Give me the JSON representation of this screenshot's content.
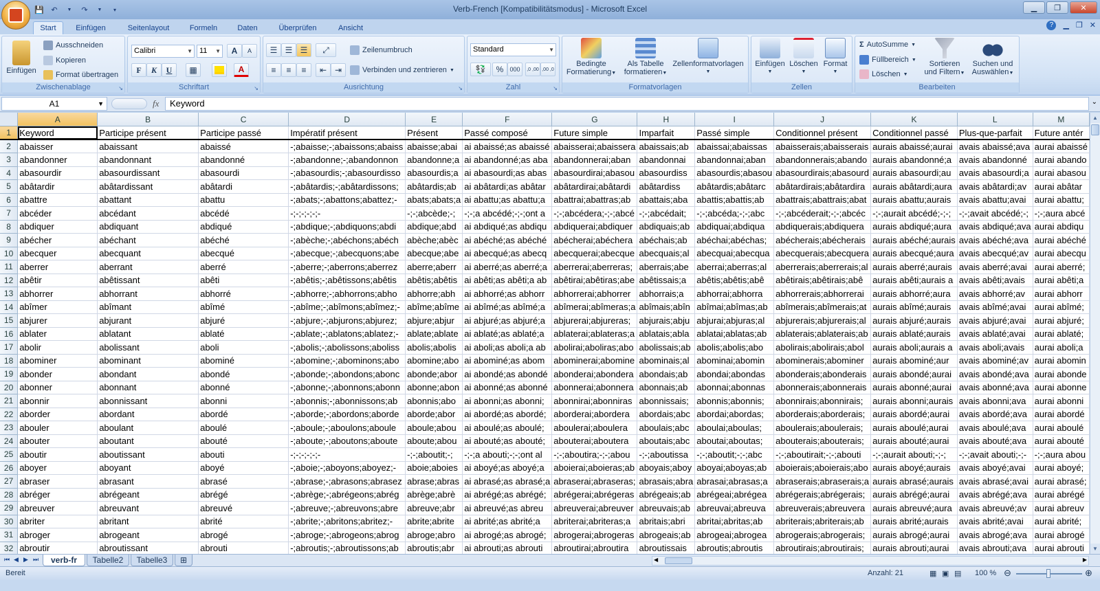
{
  "window": {
    "title": "Verb-French  [Kompatibilitätsmodus] - Microsoft Excel",
    "help_icon": "help-icon"
  },
  "ribbon_tabs": [
    "Start",
    "Einfügen",
    "Seitenlayout",
    "Formeln",
    "Daten",
    "Überprüfen",
    "Ansicht"
  ],
  "active_tab": "Start",
  "ribbon": {
    "clipboard": {
      "label": "Zwischenablage",
      "paste": "Einfügen",
      "cut": "Ausschneiden",
      "copy": "Kopieren",
      "format_painter": "Format übertragen"
    },
    "font": {
      "label": "Schriftart",
      "font_name": "Calibri",
      "font_size": "11",
      "bold": "F",
      "italic": "K",
      "underline": "U",
      "grow": "A",
      "shrink": "A",
      "fontcolor": "A"
    },
    "alignment": {
      "label": "Ausrichtung",
      "wrap": "Zeilenumbruch",
      "merge": "Verbinden und zentrieren"
    },
    "number": {
      "label": "Zahl",
      "format": "Standard",
      "percent": "%",
      "thousands": "000",
      "inc": ",0 ,00",
      "dec": ",00 ,0"
    },
    "styles": {
      "label": "Formatvorlagen",
      "conditional_1": "Bedingte",
      "conditional_2": "Formatierung",
      "table_1": "Als Tabelle",
      "table_2": "formatieren",
      "cell_styles": "Zellenformatvorlagen"
    },
    "cells": {
      "label": "Zellen",
      "insert": "Einfügen",
      "delete": "Löschen",
      "format": "Format"
    },
    "editing": {
      "label": "Bearbeiten",
      "autosum": "AutoSumme",
      "fill": "Füllbereich",
      "clear": "Löschen",
      "sort_1": "Sortieren",
      "sort_2": "und Filtern",
      "find_1": "Suchen und",
      "find_2": "Auswählen"
    }
  },
  "formula_bar": {
    "name_box": "A1",
    "fx": "fx",
    "content": "Keyword"
  },
  "sheet": {
    "columns": [
      "A",
      "B",
      "C",
      "D",
      "E",
      "F",
      "G",
      "H",
      "I",
      "J",
      "K",
      "L",
      "M"
    ],
    "rows": [
      [
        "Keyword",
        "Participe présent",
        "Participe passé",
        "Impératif présent",
        "Présent",
        "Passé composé",
        "Future simple",
        "Imparfait",
        "Passé simple",
        "Conditionnel présent",
        "Conditionnel passé",
        "Plus-que-parfait",
        "Future antér"
      ],
      [
        "abaisser",
        "abaissant",
        "abaissé",
        "-;abaisse;-;abaissons;abaiss",
        "abaisse;abai",
        "ai abaissé;as abaissé",
        "abaisserai;abaissera",
        "abaissais;ab",
        "abaissai;abaissas",
        "abaisserais;abaisserais",
        "aurais abaissé;aurai",
        "avais abaissé;ava",
        "aurai abaissé"
      ],
      [
        "abandonner",
        "abandonnant",
        "abandonné",
        "-;abandonne;-;abandonnon",
        "abandonne;a",
        "ai abandonné;as aba",
        "abandonnerai;aban",
        "abandonnai",
        "abandonnai;aban",
        "abandonnerais;abando",
        "aurais abandonné;a",
        "avais abandonné",
        "aurai abando"
      ],
      [
        "abasourdir",
        "abasourdissant",
        "abasourdi",
        "-;abasourdis;-;abasourdisso",
        "abasourdis;a",
        "ai abasourdi;as abas",
        "abasourdirai;abasou",
        "abasourdiss",
        "abasourdis;abasou",
        "abasourdirais;abasourd",
        "aurais abasourdi;au",
        "avais abasourdi;a",
        "aurai abasou"
      ],
      [
        "abâtardir",
        "abâtardissant",
        "abâtardi",
        "-;abâtardis;-;abâtardissons;",
        "abâtardis;ab",
        "ai abâtardi;as abâtar",
        "abâtardirai;abâtardi",
        "abâtardiss",
        "abâtardis;abâtarc",
        "abâtardirais;abâtardira",
        "aurais abâtardi;aura",
        "avais abâtardi;av",
        "aurai abâtar"
      ],
      [
        "abattre",
        "abattant",
        "abattu",
        "-;abats;-;abattons;abattez;-",
        "abats;abats;a",
        "ai abattu;as abattu;a",
        "abattrai;abattras;ab",
        "abattais;aba",
        "abattis;abattis;ab",
        "abattrais;abattrais;abat",
        "aurais abattu;aurais",
        "avais abattu;avai",
        "aurai abattu;"
      ],
      [
        "abcéder",
        "abcédant",
        "abcédé",
        "-;-;-;-;-;-",
        "-;-;abcède;-;",
        "-;-;a abcédé;-;-;ont a",
        "-;-;abcédera;-;-;abcé",
        "-;-;abcédait;",
        "-;-;abcéda;-;-;abc",
        "-;-;abcéderait;-;-;abcéc",
        "-;-;aurait abcédé;-;-;",
        "-;-;avait abcédé;-;",
        "-;-;aura abcé"
      ],
      [
        "abdiquer",
        "abdiquant",
        "abdiqué",
        "-;abdique;-;abdiquons;abdi",
        "abdique;abd",
        "ai abdiqué;as abdiqu",
        "abdiquerai;abdiquer",
        "abdiquais;ab",
        "abdiquai;abdiqua",
        "abdiquerais;abdiquera",
        "aurais abdiqué;aura",
        "avais abdiqué;ava",
        "aurai abdiqu"
      ],
      [
        "abécher",
        "abéchant",
        "abéché",
        "-;abèche;-;abéchons;abéch",
        "abèche;abèc",
        "ai abéché;as abéché",
        "abécherai;abéchera",
        "abéchais;ab",
        "abéchai;abéchas;",
        "abécherais;abécherais",
        "aurais abéché;aurais",
        "avais abéché;ava",
        "aurai abéché"
      ],
      [
        "abecquer",
        "abecquant",
        "abecqué",
        "-;abecque;-;abecquons;abe",
        "abecque;abe",
        "ai abecqué;as abecq",
        "abecquerai;abecque",
        "abecquais;al",
        "abecquai;abecqua",
        "abecquerais;abecquera",
        "aurais abecqué;aura",
        "avais abecqué;av",
        "aurai abecqu"
      ],
      [
        "aberrer",
        "aberrant",
        "aberré",
        "-;aberre;-;aberrons;aberrez",
        "aberre;aberr",
        "ai aberré;as aberré;a",
        "aberrerai;aberreras;",
        "aberrais;abe",
        "aberrai;aberras;al",
        "aberrerais;aberrerais;al",
        "aurais aberré;aurais",
        "avais aberré;avai",
        "aurai aberré;"
      ],
      [
        "abêtir",
        "abêtissant",
        "abêti",
        "-;abêtis;-;abêtissons;abêtis",
        "abêtis;abêtis",
        "ai abêti;as abêti;a ab",
        "abêtirai;abêtiras;abe",
        "abêtissais;a",
        "abêtis;abêtis;abê",
        "abêtirais;abêtirais;abê",
        "aurais abêti;aurais a",
        "avais abêti;avais",
        "aurai abêti;a"
      ],
      [
        "abhorrer",
        "abhorrant",
        "abhorré",
        "-;abhorre;-;abhorrons;abho",
        "abhorre;abh",
        "ai abhorré;as abhorr",
        "abhorrerai;abhorrer",
        "abhorrais;a",
        "abhorrai;abhorra",
        "abhorrerais;abhorrerai",
        "aurais abhorré;aura",
        "avais abhorré;av",
        "aurai abhorr"
      ],
      [
        "abîmer",
        "abîmant",
        "abîmé",
        "-;abîme;-;abîmons;abîmez;-",
        "abîme;abîme",
        "ai abîmé;as abîmé;a",
        "abîmerai;abîmeras;a",
        "abîmais;abîn",
        "abîmai;abîmas;ab",
        "abîmerais;abîmerais;at",
        "aurais abîmé;aurais",
        "avais abîmé;avai",
        "aurai abîmé;"
      ],
      [
        "abjurer",
        "abjurant",
        "abjuré",
        "-;abjure;-;abjurons;abjurez;",
        "abjure;abjur",
        "ai abjuré;as abjuré;a",
        "abjurerai;abjureras;",
        "abjurais;abju",
        "abjurai;abjuras;al",
        "abjurerais;abjurerais;al",
        "aurais abjuré;aurais",
        "avais abjuré;avai",
        "aurai abjuré;"
      ],
      [
        "ablater",
        "ablatant",
        "ablaté",
        "-;ablate;-;ablatons;ablatez;-",
        "ablate;ablate",
        "ai ablaté;as ablaté;a",
        "ablaterai;ablateras;a",
        "ablatais;abla",
        "ablatai;ablatas;ab",
        "ablaterais;ablaterais;ab",
        "aurais ablaté;aurais",
        "avais ablaté;avai",
        "aurai ablaté;"
      ],
      [
        "abolir",
        "abolissant",
        "aboli",
        "-;abolis;-;abolissons;aboliss",
        "abolis;abolis",
        "ai aboli;as aboli;a ab",
        "abolirai;aboliras;abo",
        "abolissais;ab",
        "abolis;abolis;abo",
        "abolirais;abolirais;abol",
        "aurais aboli;aurais a",
        "avais aboli;avais",
        "aurai aboli;a"
      ],
      [
        "abominer",
        "abominant",
        "abominé",
        "-;abomine;-;abominons;abo",
        "abomine;abo",
        "ai abominé;as abom",
        "abominerai;abomine",
        "abominais;al",
        "abominai;abomin",
        "abominerais;abominer",
        "aurais abominé;aur",
        "avais abominé;av",
        "aurai abomin"
      ],
      [
        "abonder",
        "abondant",
        "abondé",
        "-;abonde;-;abondons;abonc",
        "abonde;abor",
        "ai abondé;as abondé",
        "abonderai;abondera",
        "abondais;ab",
        "abondai;abondas",
        "abonderais;abonderais",
        "aurais abondé;aurai",
        "avais abondé;ava",
        "aurai abonde"
      ],
      [
        "abonner",
        "abonnant",
        "abonné",
        "-;abonne;-;abonnons;abonn",
        "abonne;abon",
        "ai abonné;as abonné",
        "abonnerai;abonnera",
        "abonnais;ab",
        "abonnai;abonnas",
        "abonnerais;abonnerais",
        "aurais abonné;aurai",
        "avais abonné;ava",
        "aurai abonne"
      ],
      [
        "abonnir",
        "abonnissant",
        "abonni",
        "-;abonnis;-;abonnissons;ab",
        "abonnis;abo",
        "ai abonni;as abonni;",
        "abonnirai;abonniras",
        "abonnissais;",
        "abonnis;abonnis;",
        "abonnirais;abonnirais;",
        "aurais abonni;aurais",
        "avais abonni;ava",
        "aurai abonni"
      ],
      [
        "aborder",
        "abordant",
        "abordé",
        "-;aborde;-;abordons;aborde",
        "aborde;abor",
        "ai abordé;as abordé;",
        "aborderai;abordera",
        "abordais;abc",
        "abordai;abordas;",
        "aborderais;aborderais;",
        "aurais abordé;aurai",
        "avais abordé;ava",
        "aurai abordé"
      ],
      [
        "abouler",
        "aboulant",
        "aboulé",
        "-;aboule;-;aboulons;aboule",
        "aboule;abou",
        "ai aboulé;as aboulé;",
        "aboulerai;aboulera",
        "aboulais;abc",
        "aboulai;aboulas;",
        "aboulerais;aboulerais;",
        "aurais aboulé;aurai",
        "avais aboulé;ava",
        "aurai aboulé"
      ],
      [
        "abouter",
        "aboutant",
        "abouté",
        "-;aboute;-;aboutons;aboute",
        "aboute;abou",
        "ai abouté;as abouté;",
        "abouterai;aboutera",
        "aboutais;abc",
        "aboutai;aboutas;",
        "abouterais;abouterais;",
        "aurais abouté;aurai",
        "avais abouté;ava",
        "aurai abouté"
      ],
      [
        "aboutir",
        "aboutissant",
        "abouti",
        "-;-;-;-;-;-",
        "-;-;aboutit;-;",
        "-;-;a abouti;-;-;ont al",
        "-;-;aboutira;-;-;abou",
        "-;-;aboutissa",
        "-;-;aboutit;-;-;abc",
        "-;-;aboutirait;-;-;abouti",
        "-;-;aurait abouti;-;-;",
        "-;-;avait abouti;-;-",
        "-;-;aura abou"
      ],
      [
        "aboyer",
        "aboyant",
        "aboyé",
        "-;aboie;-;aboyons;aboyez;-",
        "aboie;aboies",
        "ai aboyé;as aboyé;a",
        "aboierai;aboieras;ab",
        "aboyais;aboy",
        "aboyai;aboyas;ab",
        "aboierais;aboierais;abo",
        "aurais aboyé;aurais",
        "avais aboyé;avai",
        "aurai aboyé;"
      ],
      [
        "abraser",
        "abrasant",
        "abrasé",
        "-;abrase;-;abrasons;abrasez",
        "abrase;abras",
        "ai abrasé;as abrasé;a",
        "abraserai;abraseras;",
        "abrasais;abra",
        "abrasai;abrasas;a",
        "abraserais;abraserais;a",
        "aurais abrasé;aurais",
        "avais abrasé;avai",
        "aurai abrasé;"
      ],
      [
        "abréger",
        "abrégeant",
        "abrégé",
        "-;abrège;-;abrégeons;abrég",
        "abrège;abrè",
        "ai abrégé;as abrégé;",
        "abrégerai;abrégeras",
        "abrégeais;ab",
        "abrégeai;abrégea",
        "abrégerais;abrégerais;",
        "aurais abrégé;aurai",
        "avais abrégé;ava",
        "aurai abrégé"
      ],
      [
        "abreuver",
        "abreuvant",
        "abreuvé",
        "-;abreuve;-;abreuvons;abre",
        "abreuve;abr",
        "ai abreuvé;as abreu",
        "abreuverai;abreuver",
        "abreuvais;ab",
        "abreuvai;abreuva",
        "abreuverais;abreuvera",
        "aurais abreuvé;aura",
        "avais abreuvé;av",
        "aurai abreuv"
      ],
      [
        "abriter",
        "abritant",
        "abrité",
        "-;abrite;-;abritons;abritez;-",
        "abrite;abrite",
        "ai abrité;as abrité;a",
        "abriterai;abriteras;a",
        "abritais;abri",
        "abritai;abritas;ab",
        "abriterais;abriterais;ab",
        "aurais abrité;aurais",
        "avais abrité;avai",
        "aurai abrité;"
      ],
      [
        "abroger",
        "abrogeant",
        "abrogé",
        "-;abroge;-;abrogeons;abrog",
        "abroge;abro",
        "ai abrogé;as abrogé;",
        "abrogerai;abrogeras",
        "abrogeais;ab",
        "abrogeai;abrogea",
        "abrogerais;abrogerais;",
        "aurais abrogé;aurai",
        "avais abrogé;ava",
        "aurai abrogé"
      ],
      [
        "abroutir",
        "abroutissant",
        "abrouti",
        "-;abroutis;-;abroutissons;ab",
        "abroutis;abr",
        "ai abrouti;as abrouti",
        "abroutirai;abroutira",
        "abroutissais",
        "abroutis;abroutis",
        "abroutirais;abroutirais;",
        "aurais abrouti;aurai",
        "avais abrouti;ava",
        "aurai abrouti"
      ]
    ]
  },
  "sheet_tabs": [
    "verb-fr",
    "Tabelle2",
    "Tabelle3"
  ],
  "active_sheet": "verb-fr",
  "status": {
    "ready": "Bereit",
    "count": "Anzahl: 21",
    "zoom": "100 %"
  },
  "colors": {
    "accent": "#15428b",
    "selected_header": "#f1c15f",
    "grid": "#d0d7e5"
  }
}
